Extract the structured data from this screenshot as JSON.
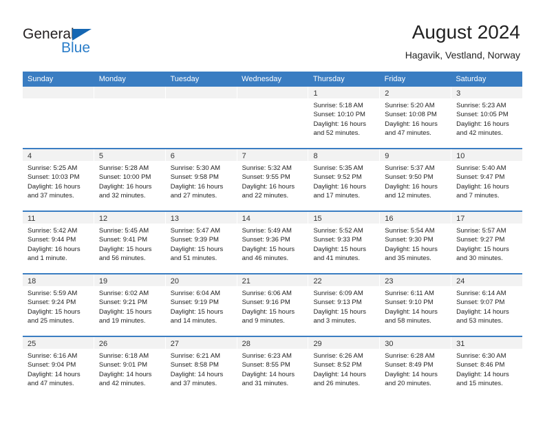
{
  "brand": {
    "name_dark": "General",
    "name_blue": "Blue",
    "accent_color": "#2a7dc9",
    "triangle_color": "#1567b3"
  },
  "header": {
    "title": "August 2024",
    "subtitle": "Hagavik, Vestland, Norway"
  },
  "calendar": {
    "header_bg": "#3a7dc2",
    "day_band_bg": "#f2f2f2",
    "weekdays": [
      "Sunday",
      "Monday",
      "Tuesday",
      "Wednesday",
      "Thursday",
      "Friday",
      "Saturday"
    ],
    "weeks": [
      [
        {
          "day": "",
          "lines": []
        },
        {
          "day": "",
          "lines": []
        },
        {
          "day": "",
          "lines": []
        },
        {
          "day": "",
          "lines": []
        },
        {
          "day": "1",
          "lines": [
            "Sunrise: 5:18 AM",
            "Sunset: 10:10 PM",
            "Daylight: 16 hours",
            "and 52 minutes."
          ]
        },
        {
          "day": "2",
          "lines": [
            "Sunrise: 5:20 AM",
            "Sunset: 10:08 PM",
            "Daylight: 16 hours",
            "and 47 minutes."
          ]
        },
        {
          "day": "3",
          "lines": [
            "Sunrise: 5:23 AM",
            "Sunset: 10:05 PM",
            "Daylight: 16 hours",
            "and 42 minutes."
          ]
        }
      ],
      [
        {
          "day": "4",
          "lines": [
            "Sunrise: 5:25 AM",
            "Sunset: 10:03 PM",
            "Daylight: 16 hours",
            "and 37 minutes."
          ]
        },
        {
          "day": "5",
          "lines": [
            "Sunrise: 5:28 AM",
            "Sunset: 10:00 PM",
            "Daylight: 16 hours",
            "and 32 minutes."
          ]
        },
        {
          "day": "6",
          "lines": [
            "Sunrise: 5:30 AM",
            "Sunset: 9:58 PM",
            "Daylight: 16 hours",
            "and 27 minutes."
          ]
        },
        {
          "day": "7",
          "lines": [
            "Sunrise: 5:32 AM",
            "Sunset: 9:55 PM",
            "Daylight: 16 hours",
            "and 22 minutes."
          ]
        },
        {
          "day": "8",
          "lines": [
            "Sunrise: 5:35 AM",
            "Sunset: 9:52 PM",
            "Daylight: 16 hours",
            "and 17 minutes."
          ]
        },
        {
          "day": "9",
          "lines": [
            "Sunrise: 5:37 AM",
            "Sunset: 9:50 PM",
            "Daylight: 16 hours",
            "and 12 minutes."
          ]
        },
        {
          "day": "10",
          "lines": [
            "Sunrise: 5:40 AM",
            "Sunset: 9:47 PM",
            "Daylight: 16 hours",
            "and 7 minutes."
          ]
        }
      ],
      [
        {
          "day": "11",
          "lines": [
            "Sunrise: 5:42 AM",
            "Sunset: 9:44 PM",
            "Daylight: 16 hours",
            "and 1 minute."
          ]
        },
        {
          "day": "12",
          "lines": [
            "Sunrise: 5:45 AM",
            "Sunset: 9:41 PM",
            "Daylight: 15 hours",
            "and 56 minutes."
          ]
        },
        {
          "day": "13",
          "lines": [
            "Sunrise: 5:47 AM",
            "Sunset: 9:39 PM",
            "Daylight: 15 hours",
            "and 51 minutes."
          ]
        },
        {
          "day": "14",
          "lines": [
            "Sunrise: 5:49 AM",
            "Sunset: 9:36 PM",
            "Daylight: 15 hours",
            "and 46 minutes."
          ]
        },
        {
          "day": "15",
          "lines": [
            "Sunrise: 5:52 AM",
            "Sunset: 9:33 PM",
            "Daylight: 15 hours",
            "and 41 minutes."
          ]
        },
        {
          "day": "16",
          "lines": [
            "Sunrise: 5:54 AM",
            "Sunset: 9:30 PM",
            "Daylight: 15 hours",
            "and 35 minutes."
          ]
        },
        {
          "day": "17",
          "lines": [
            "Sunrise: 5:57 AM",
            "Sunset: 9:27 PM",
            "Daylight: 15 hours",
            "and 30 minutes."
          ]
        }
      ],
      [
        {
          "day": "18",
          "lines": [
            "Sunrise: 5:59 AM",
            "Sunset: 9:24 PM",
            "Daylight: 15 hours",
            "and 25 minutes."
          ]
        },
        {
          "day": "19",
          "lines": [
            "Sunrise: 6:02 AM",
            "Sunset: 9:21 PM",
            "Daylight: 15 hours",
            "and 19 minutes."
          ]
        },
        {
          "day": "20",
          "lines": [
            "Sunrise: 6:04 AM",
            "Sunset: 9:19 PM",
            "Daylight: 15 hours",
            "and 14 minutes."
          ]
        },
        {
          "day": "21",
          "lines": [
            "Sunrise: 6:06 AM",
            "Sunset: 9:16 PM",
            "Daylight: 15 hours",
            "and 9 minutes."
          ]
        },
        {
          "day": "22",
          "lines": [
            "Sunrise: 6:09 AM",
            "Sunset: 9:13 PM",
            "Daylight: 15 hours",
            "and 3 minutes."
          ]
        },
        {
          "day": "23",
          "lines": [
            "Sunrise: 6:11 AM",
            "Sunset: 9:10 PM",
            "Daylight: 14 hours",
            "and 58 minutes."
          ]
        },
        {
          "day": "24",
          "lines": [
            "Sunrise: 6:14 AM",
            "Sunset: 9:07 PM",
            "Daylight: 14 hours",
            "and 53 minutes."
          ]
        }
      ],
      [
        {
          "day": "25",
          "lines": [
            "Sunrise: 6:16 AM",
            "Sunset: 9:04 PM",
            "Daylight: 14 hours",
            "and 47 minutes."
          ]
        },
        {
          "day": "26",
          "lines": [
            "Sunrise: 6:18 AM",
            "Sunset: 9:01 PM",
            "Daylight: 14 hours",
            "and 42 minutes."
          ]
        },
        {
          "day": "27",
          "lines": [
            "Sunrise: 6:21 AM",
            "Sunset: 8:58 PM",
            "Daylight: 14 hours",
            "and 37 minutes."
          ]
        },
        {
          "day": "28",
          "lines": [
            "Sunrise: 6:23 AM",
            "Sunset: 8:55 PM",
            "Daylight: 14 hours",
            "and 31 minutes."
          ]
        },
        {
          "day": "29",
          "lines": [
            "Sunrise: 6:26 AM",
            "Sunset: 8:52 PM",
            "Daylight: 14 hours",
            "and 26 minutes."
          ]
        },
        {
          "day": "30",
          "lines": [
            "Sunrise: 6:28 AM",
            "Sunset: 8:49 PM",
            "Daylight: 14 hours",
            "and 20 minutes."
          ]
        },
        {
          "day": "31",
          "lines": [
            "Sunrise: 6:30 AM",
            "Sunset: 8:46 PM",
            "Daylight: 14 hours",
            "and 15 minutes."
          ]
        }
      ]
    ]
  }
}
